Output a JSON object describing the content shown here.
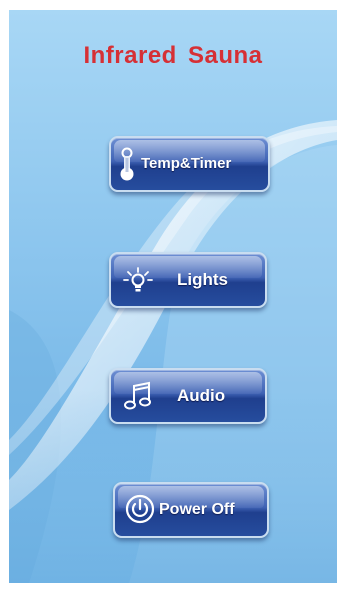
{
  "app": {
    "title": "Infrared  Sauna"
  },
  "buttons": {
    "temp_timer": {
      "label": "Temp&Timer",
      "icon": "thermometer-icon"
    },
    "lights": {
      "label": "Lights",
      "icon": "lightbulb-icon"
    },
    "audio": {
      "label": "Audio",
      "icon": "music-note-icon"
    },
    "power_off": {
      "label": "Power Off",
      "icon": "power-icon"
    }
  },
  "colors": {
    "title": "#d63035",
    "background": "#8dc6ee",
    "button": "#2d4fa3",
    "button_text": "#ffffff"
  }
}
